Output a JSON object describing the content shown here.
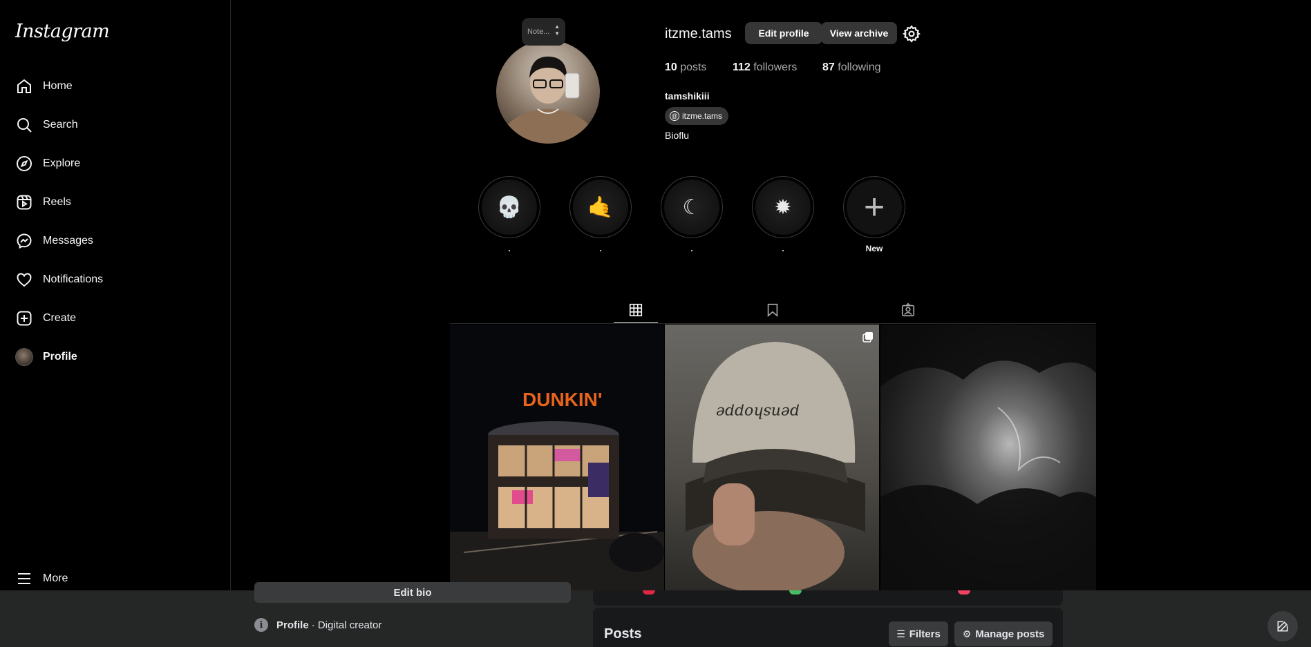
{
  "app": {
    "logo": "Instagram"
  },
  "sidebar": {
    "items": [
      {
        "label": "Home",
        "icon": "home-icon"
      },
      {
        "label": "Search",
        "icon": "search-icon"
      },
      {
        "label": "Explore",
        "icon": "compass-icon"
      },
      {
        "label": "Reels",
        "icon": "reels-icon"
      },
      {
        "label": "Messages",
        "icon": "messenger-icon"
      },
      {
        "label": "Notifications",
        "icon": "heart-icon"
      },
      {
        "label": "Create",
        "icon": "plus-square-icon"
      },
      {
        "label": "Profile",
        "icon": "avatar"
      }
    ],
    "more_label": "More"
  },
  "profile": {
    "note_placeholder": "Note...",
    "username": "itzme.tams",
    "edit_profile_label": "Edit profile",
    "view_archive_label": "View archive",
    "posts_count": "10",
    "posts_label": "posts",
    "followers_count": "112",
    "followers_label": "followers",
    "following_count": "87",
    "following_label": "following",
    "full_name": "tamshikiii",
    "threads_handle": "itzme.tams",
    "bio": "Bioflu"
  },
  "highlights": [
    {
      "label": ".",
      "glyph": "💀"
    },
    {
      "label": ".",
      "glyph": "🤙"
    },
    {
      "label": ".",
      "glyph": "☾"
    },
    {
      "label": ".",
      "glyph": "✹"
    },
    {
      "label": "New",
      "glyph": "+"
    }
  ],
  "tabs": [
    {
      "name": "posts",
      "icon": "grid-icon",
      "active": true
    },
    {
      "name": "saved",
      "icon": "bookmark-icon",
      "active": false
    },
    {
      "name": "tagged",
      "icon": "tagged-icon",
      "active": false
    }
  ],
  "posts": [
    {
      "sign": "DUNKIN'"
    },
    {
      "cap_text": "penshoppe"
    },
    {
      "desc": ""
    }
  ],
  "facebook_overlay": {
    "edit_bio_label": "Edit bio",
    "profile_label": "Profile",
    "profile_category": "· Digital creator",
    "posts_title": "Posts",
    "filters_label": "Filters",
    "manage_posts_label": "Manage posts"
  }
}
